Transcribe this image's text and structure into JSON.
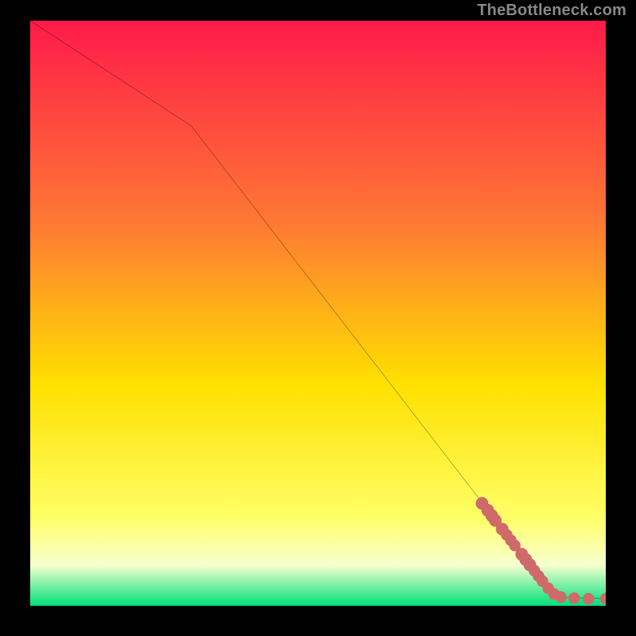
{
  "attribution": "TheBottleneck.com",
  "colors": {
    "line": "#000000",
    "markers": "#cf6a6a",
    "gradient_top": "#ff1a4a",
    "gradient_mid_upper": "#ff7a33",
    "gradient_mid": "#ffe000",
    "gradient_mid_lower": "#ffff66",
    "gradient_lower_strip": "#f8ffd0",
    "gradient_bottom": "#00e07a"
  },
  "chart_data": {
    "type": "line",
    "title": "",
    "xlabel": "",
    "ylabel": "",
    "xlim": [
      0,
      100
    ],
    "ylim": [
      0,
      100
    ],
    "line_points": [
      {
        "x": 0,
        "y": 100
      },
      {
        "x": 28,
        "y": 82
      },
      {
        "x": 90,
        "y": 3
      },
      {
        "x": 92,
        "y": 1.5
      },
      {
        "x": 100,
        "y": 1.2
      }
    ],
    "markers": [
      {
        "x": 78.5,
        "y": 17.5,
        "r": 1.1
      },
      {
        "x": 79.5,
        "y": 16.3,
        "r": 1.1
      },
      {
        "x": 80.2,
        "y": 15.4,
        "r": 1.1
      },
      {
        "x": 80.8,
        "y": 14.6,
        "r": 1.1
      },
      {
        "x": 82.0,
        "y": 13.1,
        "r": 1.1
      },
      {
        "x": 82.8,
        "y": 12.1,
        "r": 1.0
      },
      {
        "x": 83.5,
        "y": 11.2,
        "r": 1.0
      },
      {
        "x": 84.2,
        "y": 10.3,
        "r": 1.0
      },
      {
        "x": 85.4,
        "y": 8.8,
        "r": 1.1
      },
      {
        "x": 86.1,
        "y": 7.9,
        "r": 1.1
      },
      {
        "x": 86.8,
        "y": 7.0,
        "r": 1.1
      },
      {
        "x": 87.6,
        "y": 6.0,
        "r": 1.0
      },
      {
        "x": 88.3,
        "y": 5.1,
        "r": 1.0
      },
      {
        "x": 89.0,
        "y": 4.2,
        "r": 1.0
      },
      {
        "x": 90.0,
        "y": 3.0,
        "r": 1.0
      },
      {
        "x": 91.0,
        "y": 2.0,
        "r": 1.0
      },
      {
        "x": 92.2,
        "y": 1.5,
        "r": 1.0
      },
      {
        "x": 94.5,
        "y": 1.3,
        "r": 1.0
      },
      {
        "x": 97.0,
        "y": 1.2,
        "r": 1.0
      },
      {
        "x": 100.0,
        "y": 1.2,
        "r": 1.0
      }
    ]
  }
}
